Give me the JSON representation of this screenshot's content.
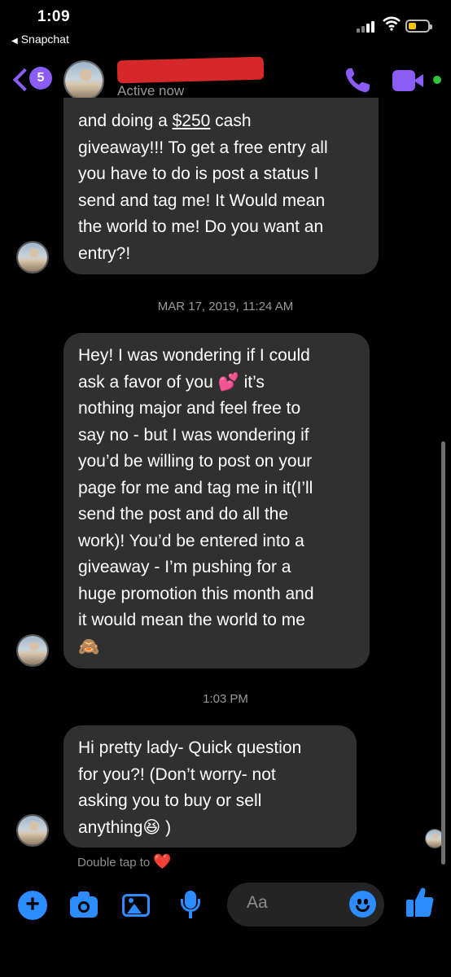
{
  "status_bar": {
    "time": "1:09",
    "back_app": "Snapchat"
  },
  "header": {
    "unread_count": "5",
    "contact_status": "Active now",
    "accent_color": "#8b5cf6",
    "online_color": "#31c43a"
  },
  "messages": [
    {
      "lines_before": "and doing a ",
      "amount": "$250",
      "lines_after": " cash\ngiveaway!!! To get a free entry all\nyou have to do is post a status I\nsend and tag me! It Would mean\nthe world to me! Do you want an\nentry?!"
    },
    {
      "timestamp": "MAR 17, 2019, 11:24 AM",
      "text": "Hey! I was wondering if I could\nask a favor of you 💕 it’s\nnothing major and feel free to\nsay no - but I was wondering if\nyou’d be willing to post on your\npage for me and tag me in it(I’ll\nsend the post and do all the\nwork)! You’d be entered into a\ngiveaway - I’m pushing for a\nhuge promotion this month and\nit would mean the world to me\n🙈"
    },
    {
      "timestamp": "1:03 PM",
      "text": "Hi pretty lady- Quick question\nfor you?! (Don’t worry- not\nasking you to buy or sell\nanything😆 )"
    }
  ],
  "hint": {
    "double_tap": "Double tap to",
    "heart": "❤️"
  },
  "composer": {
    "placeholder": "Aa",
    "icons": [
      "plus-icon",
      "camera-icon",
      "image-icon",
      "microphone-icon",
      "emoji-icon",
      "thumbs-up-icon"
    ],
    "icon_color": "#2d8cff"
  }
}
